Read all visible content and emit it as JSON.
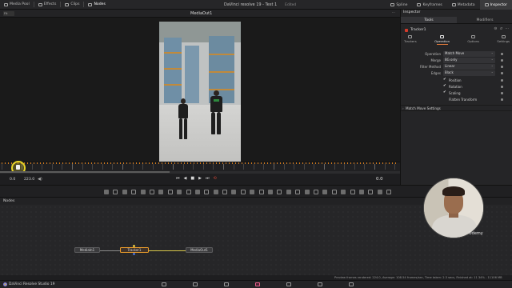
{
  "topbar": {
    "items": [
      "Media Pool",
      "Effects",
      "Clips",
      "Nodes"
    ],
    "title": "DaVinci resolve 19 - Test 1",
    "edited": "Edited",
    "right_items": [
      "Spline",
      "Keyframes",
      "Metadata",
      "Inspector"
    ]
  },
  "viewer": {
    "zoom_label": "Fit",
    "name": "MediaOut1",
    "more": "⋯"
  },
  "transport": {
    "start": "0.0",
    "end": "223.0",
    "time": "0.0",
    "buttons": [
      "⏮",
      "◀",
      "■",
      "▶",
      "⏭"
    ],
    "loop": "⟲",
    "volume": "◀)"
  },
  "nodes": {
    "panel_label": "Nodes",
    "items": [
      "MediaIn1",
      "Tracker1",
      "MediaOut1"
    ]
  },
  "status": {
    "text": "Preview frames rendered: 224.0,  Average: 108.54 frames/sec,  Time taken: 2.3 secs,  Finished at: 11      34% - 11106 MB"
  },
  "bottombar": {
    "app_name": "DaVinci Resolve Studio 19"
  },
  "inspector": {
    "title": "Inspector",
    "tabs": [
      "Tools",
      "Modifiers"
    ],
    "node_name": "Tracker1",
    "subtabs": [
      "Trackers",
      "Operation",
      "Options",
      "Settings"
    ],
    "fields": [
      {
        "label": "Operation",
        "value": "Match Move"
      },
      {
        "label": "Merge",
        "value": "BG only"
      },
      {
        "label": "Filter Method",
        "value": "Linear"
      },
      {
        "label": "Edges",
        "value": "Black"
      }
    ],
    "checks": [
      {
        "label": "Position",
        "checked": true
      },
      {
        "label": "Rotation",
        "checked": true
      },
      {
        "label": "Scaling",
        "checked": true
      },
      {
        "label": "Flatten Transform",
        "checked": false
      }
    ],
    "section": "Match Move Settings"
  },
  "watermark": "Udemy",
  "colors": {
    "accent": "#e89a2a",
    "playhead": "#e8d528",
    "loop": "#e04a3a",
    "node_red": "#d53b2b"
  }
}
